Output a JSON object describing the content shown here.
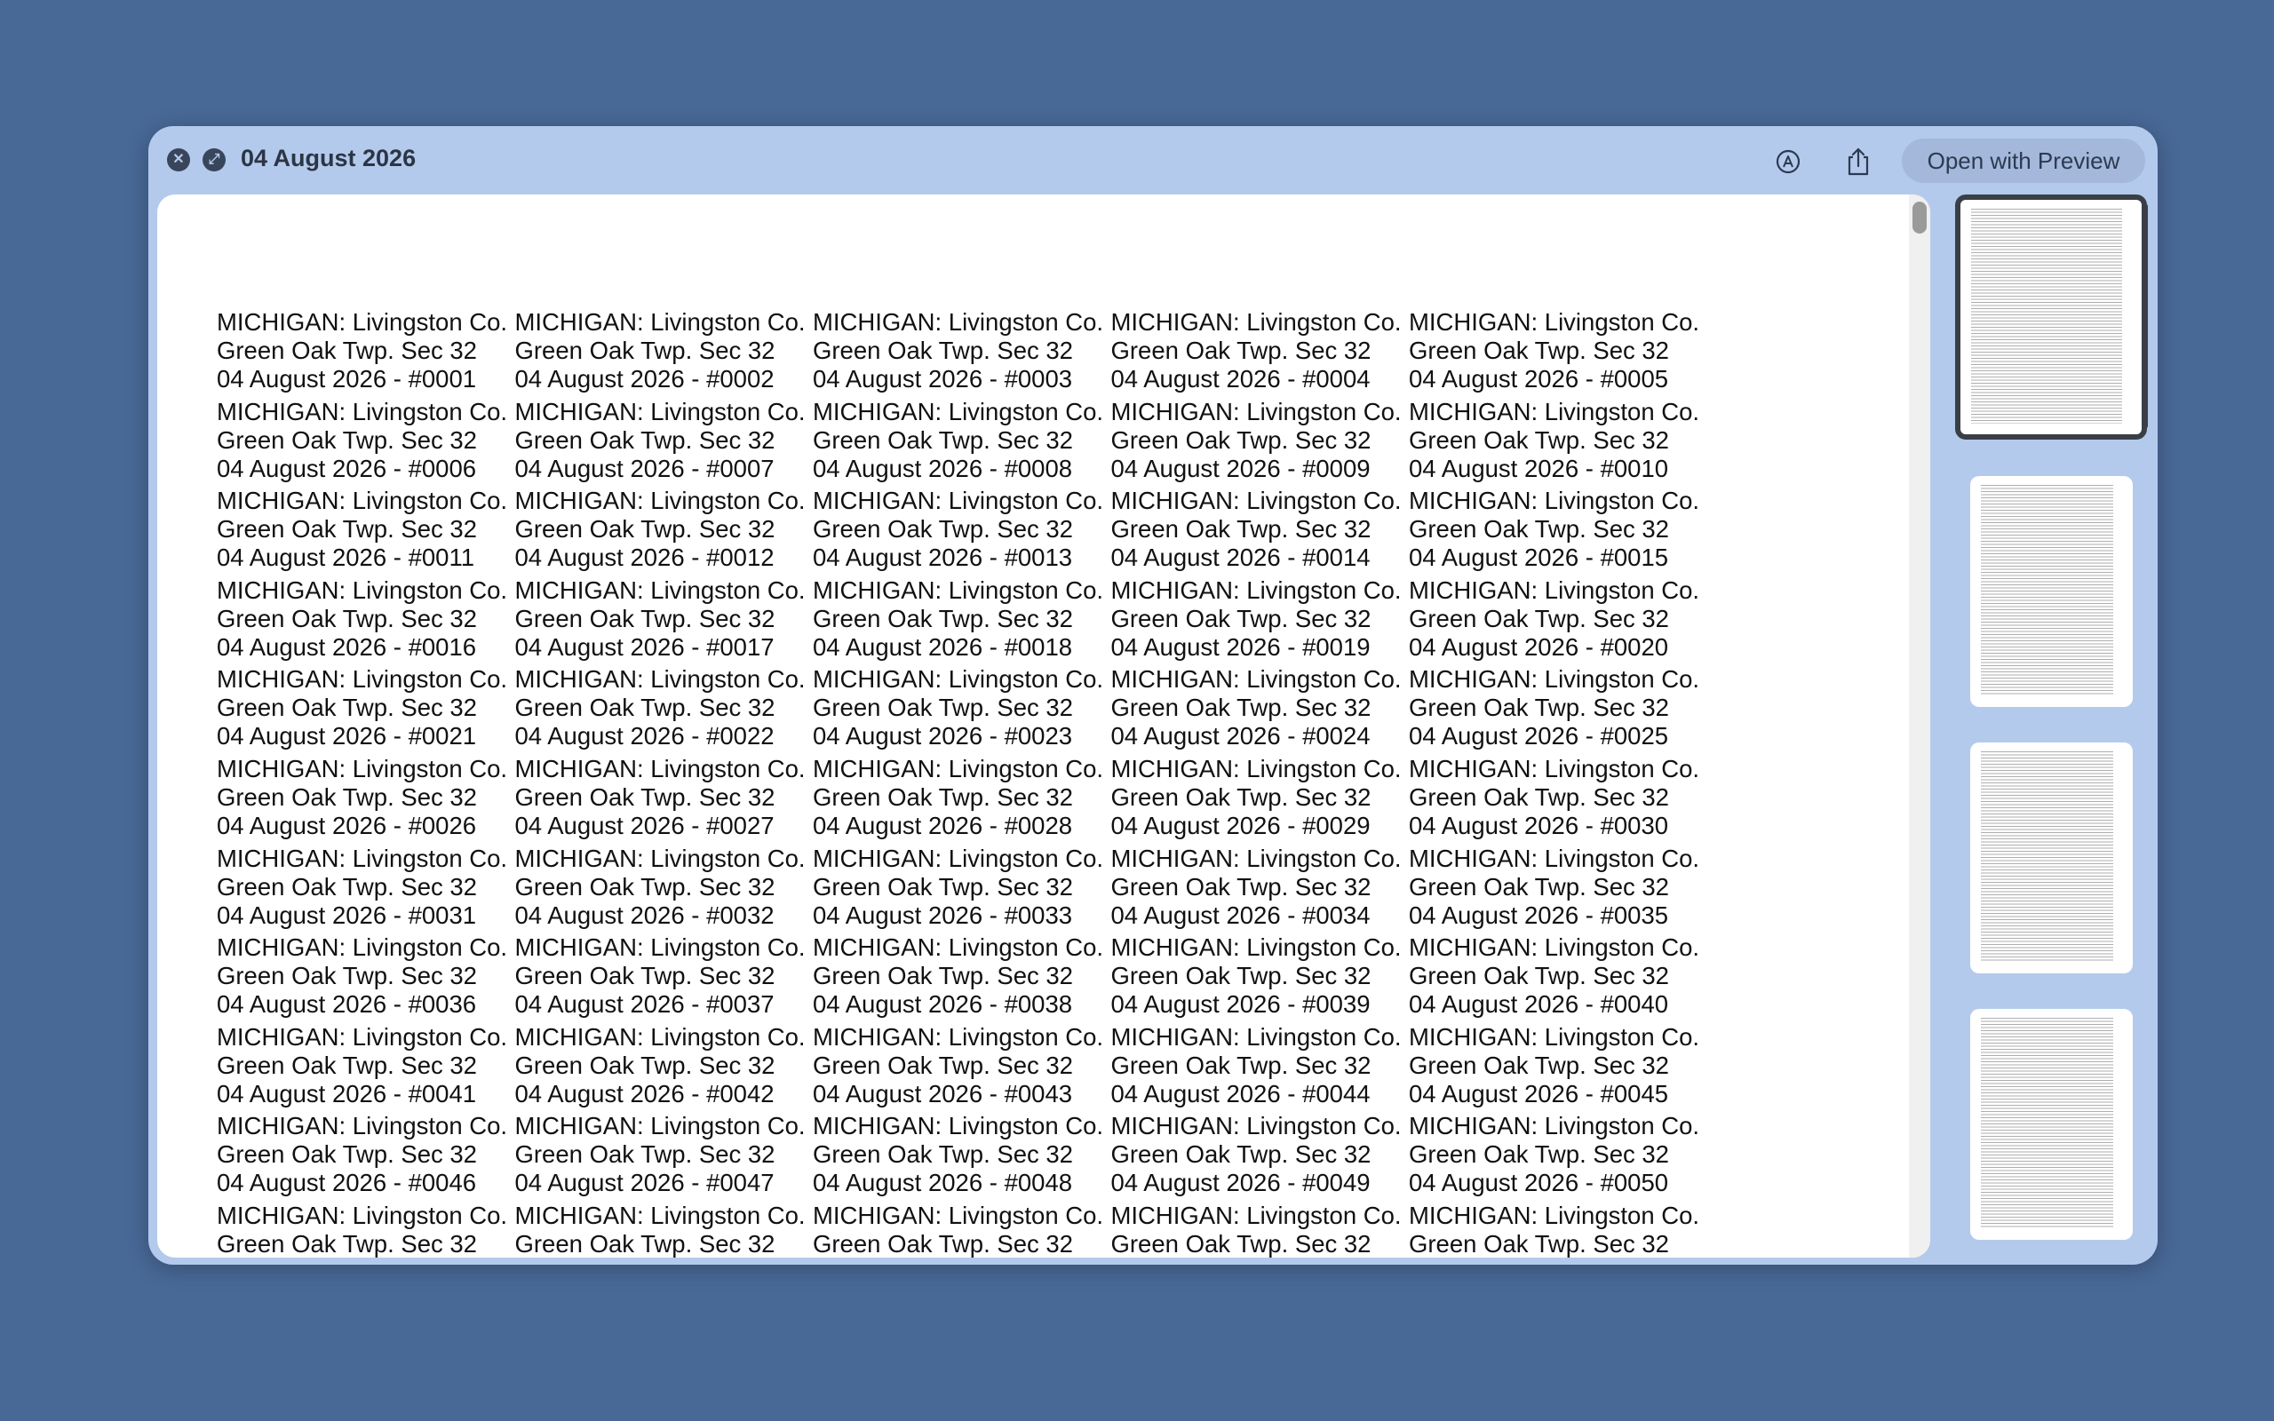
{
  "window": {
    "title": "04 August 2026",
    "close_glyph": "✕",
    "fullscreen_glyph": "⤢",
    "open_with_label": "Open with Preview"
  },
  "icons": {
    "close": "close-icon",
    "fullscreen": "fullscreen-icon",
    "markup": "markup-icon",
    "share": "share-icon"
  },
  "colors": {
    "desktop": "#486896",
    "window": "#b4caec",
    "button": "#a3b8da",
    "document": "#ffffff"
  },
  "document": {
    "label_line1": "MICHIGAN: Livingston Co.",
    "label_line2": "Green Oak Twp. Sec 32",
    "date_prefix": "04 August 2026 - #",
    "columns": 5,
    "visible_count": 55,
    "visible_full_rows": 10
  },
  "sidebar": {
    "page_count": 4,
    "selected_page": 1
  }
}
